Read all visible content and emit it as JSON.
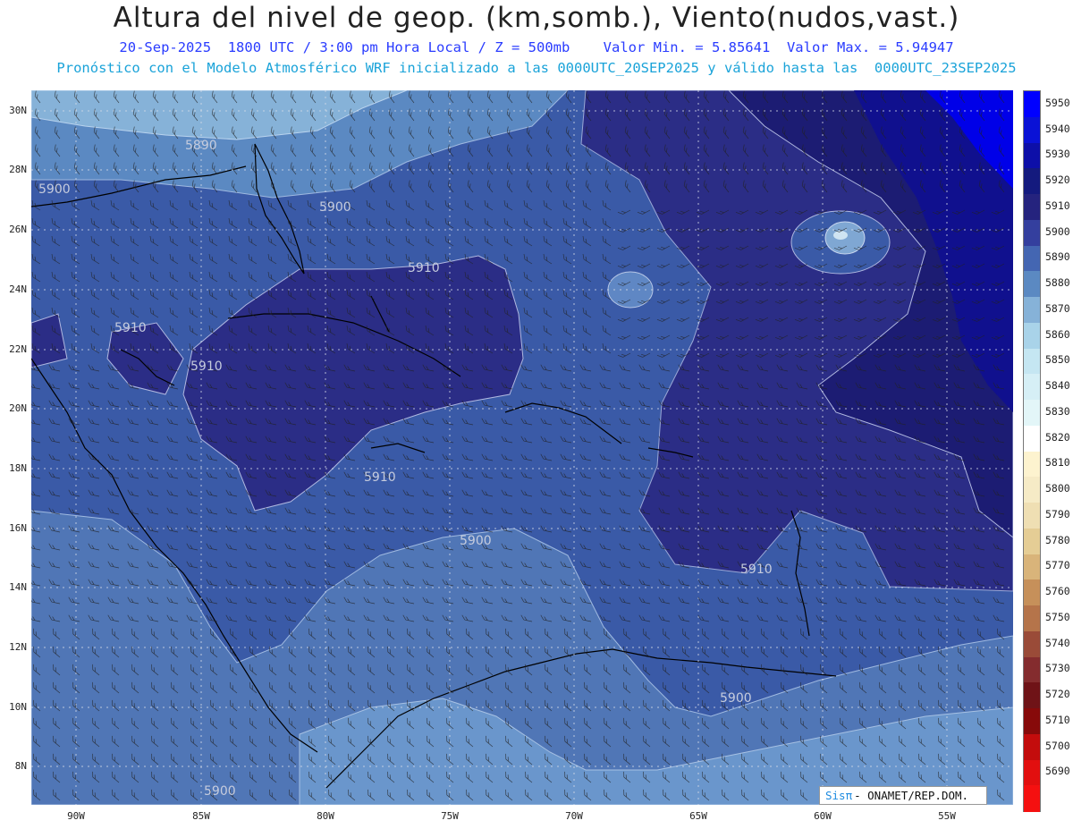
{
  "title": "Altura del nivel de geop. (km,somb.), Viento(nudos,vast.)",
  "subtitle_line1": "20-Sep-2025  1800 UTC / 3:00 pm Hora Local / Z = 500mb    Valor Min. = 5.85641  Valor Max. = 5.94947",
  "subtitle_line2": "Pronóstico con el Modelo Atmosférico WRF inicializado a las 0000UTC_20SEP2025 y válido hasta las  0000UTC_23SEP2025",
  "y_ticks": [
    "30N",
    "28N",
    "26N",
    "24N",
    "22N",
    "20N",
    "18N",
    "16N",
    "14N",
    "12N",
    "10N",
    "8N"
  ],
  "x_ticks": [
    "90W",
    "85W",
    "80W",
    "75W",
    "70W",
    "65W",
    "60W",
    "55W"
  ],
  "contour_labels": [
    "5890",
    "5900",
    "5900",
    "5910",
    "5910",
    "5910",
    "5910",
    "5900",
    "5910",
    "5900",
    "5900"
  ],
  "legend": {
    "levels": [
      "5950",
      "5940",
      "5930",
      "5920",
      "5910",
      "5900",
      "5890",
      "5880",
      "5870",
      "5860",
      "5850",
      "5840",
      "5830",
      "5820",
      "5810",
      "5800",
      "5790",
      "5780",
      "5770",
      "5760",
      "5750",
      "5740",
      "5730",
      "5720",
      "5710",
      "5700",
      "5690"
    ],
    "colors": [
      "#0000ff",
      "#0a12d6",
      "#0d0fa8",
      "#141a7e",
      "#25237e",
      "#343f9e",
      "#4466b2",
      "#5b89c2",
      "#86b2d8",
      "#a9d3e9",
      "#c5e6f2",
      "#d6eff6",
      "#e3f6f8",
      "#ffffff",
      "#fdf3cf",
      "#f6ebc6",
      "#efdfb3",
      "#e5cd95",
      "#d9b47a",
      "#c6905a",
      "#b5744a",
      "#9a4b38",
      "#842c2e",
      "#6f1317",
      "#870a0a",
      "#c30c0c",
      "#e20f0f",
      "#f51010"
    ]
  },
  "credit_symbol": "Sisπ",
  "credit_text": "- ONAMET/REP.DOM."
}
